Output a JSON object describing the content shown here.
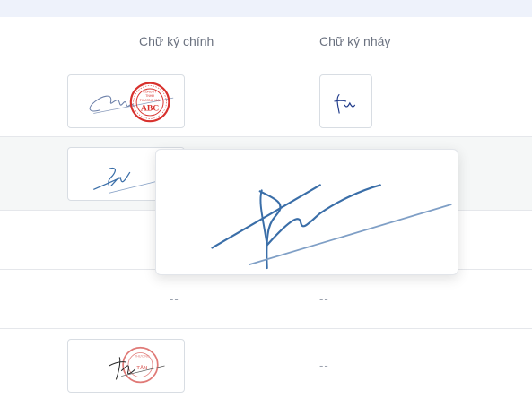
{
  "table": {
    "columns": {
      "main_signature": "Chữ ký chính",
      "initial_signature": "Chữ ký nháy"
    },
    "rows": [
      {
        "main": "signature-image-with-company-seal",
        "initial": "initial-signature-image"
      },
      {
        "main": "signature-image",
        "initial": ""
      },
      {
        "main": "",
        "initial": ""
      },
      {
        "main": "--",
        "initial": "--"
      },
      {
        "main": "signature-image-with-company-seal",
        "initial": "--"
      }
    ]
  },
  "seal_row1": {
    "line1": "CÔNG TY",
    "line2": "TNHH",
    "line3": "THƯƠNG MẠI",
    "name": "ABC"
  },
  "seal_row5": {
    "line1": "THƯƠNG",
    "name": "TÂN"
  },
  "colors": {
    "seal_red": "#d8312d",
    "ink_blue": "#3a6ea8"
  }
}
